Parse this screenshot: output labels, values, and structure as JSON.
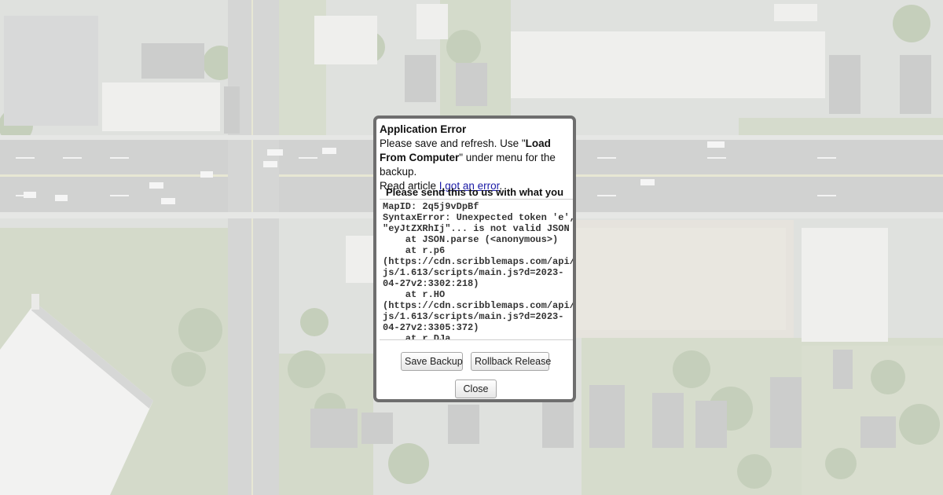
{
  "dialog": {
    "title": "Application Error",
    "message_part1": "Please save and refresh. Use \"",
    "message_bold": "Load From Computer",
    "message_part2": "\" under menu for the backup.",
    "read_article_prefix": "Read article ",
    "article_link": "I got an error",
    "article_suffix": ".",
    "send_text": "Please send this to us with what you",
    "error_log": "MapID: 2q5j9vDpBf\nSyntaxError: Unexpected token 'e',\n\"eyJtZXRhIj\"... is not valid JSON\n    at JSON.parse (<anonymous>)\n    at r.p6\n(https://cdn.scribblemaps.com/api/\njs/1.613/scripts/main.js?d=2023-\n04-27v2:3302:218)\n    at r.HO\n(https://cdn.scribblemaps.com/api/\njs/1.613/scripts/main.js?d=2023-\n04-27v2:3305:372)\n    at r.DJa",
    "buttons": {
      "save_backup": "Save Backup",
      "rollback_release": "Rollback Release",
      "close": "Close"
    }
  },
  "colors": {
    "dialog_border": "#6e6e6e",
    "link": "#1a1aa6"
  }
}
